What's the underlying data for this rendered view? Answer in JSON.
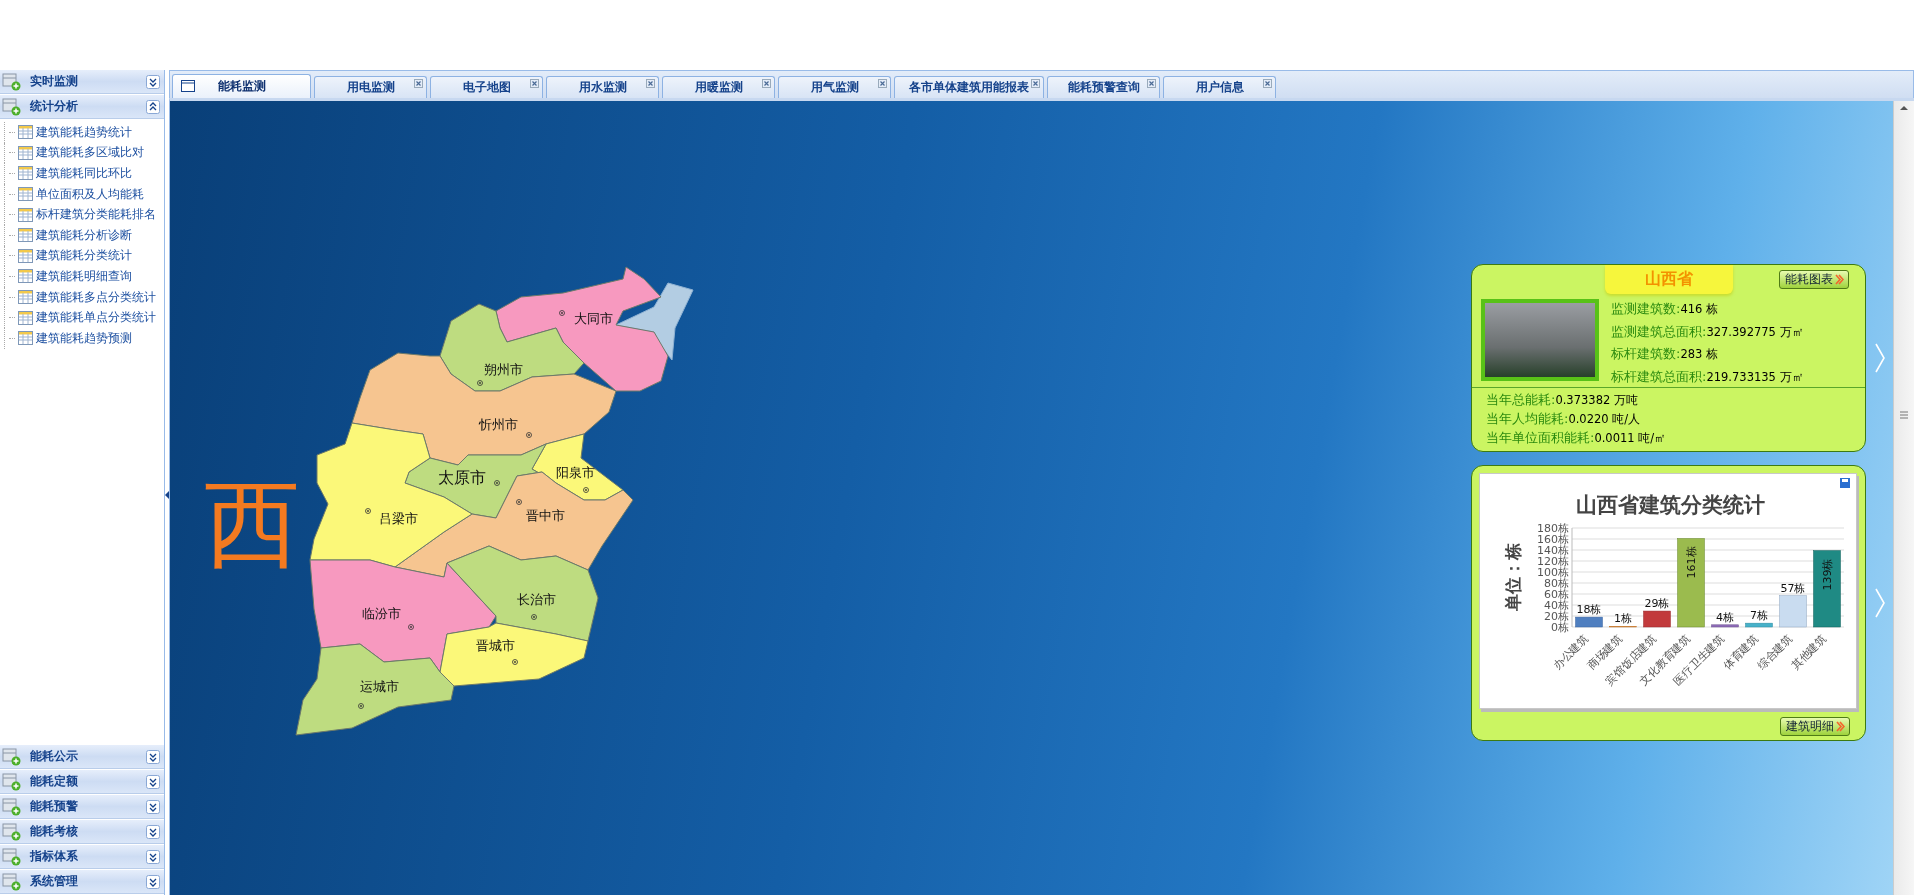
{
  "sidebar": {
    "sections": [
      {
        "label": "实时监测",
        "expanded": false
      },
      {
        "label": "统计分析",
        "expanded": true,
        "items": [
          "建筑能耗趋势统计",
          "建筑能耗多区域比对",
          "建筑能耗同比环比",
          "单位面积及人均能耗",
          "标杆建筑分类能耗排名",
          "建筑能耗分析诊断",
          "建筑能耗分类统计",
          "建筑能耗明细查询",
          "建筑能耗多点分类统计",
          "建筑能耗单点分类统计",
          "建筑能耗趋势预测"
        ]
      },
      {
        "label": "能耗公示",
        "expanded": false
      },
      {
        "label": "能耗定额",
        "expanded": false
      },
      {
        "label": "能耗预警",
        "expanded": false
      },
      {
        "label": "能耗考核",
        "expanded": false
      },
      {
        "label": "指标体系",
        "expanded": false
      },
      {
        "label": "系统管理",
        "expanded": false
      }
    ]
  },
  "tabs": [
    {
      "label": "能耗监测",
      "selected": true,
      "closable": false
    },
    {
      "label": "用电监测",
      "selected": false,
      "closable": true
    },
    {
      "label": "电子地图",
      "selected": false,
      "closable": true
    },
    {
      "label": "用水监测",
      "selected": false,
      "closable": true
    },
    {
      "label": "用暖监测",
      "selected": false,
      "closable": true
    },
    {
      "label": "用气监测",
      "selected": false,
      "closable": true
    },
    {
      "label": "各市单体建筑用能报表",
      "selected": false,
      "closable": true
    },
    {
      "label": "能耗预警查询",
      "selected": false,
      "closable": true
    },
    {
      "label": "用户信息",
      "selected": false,
      "closable": true
    }
  ],
  "map": {
    "title_fragment": "西",
    "regions": [
      {
        "name": "大同市",
        "color": "#f799bf"
      },
      {
        "name": "朔州市",
        "color": "#bedc80"
      },
      {
        "name": "忻州市",
        "color": "#f6c590"
      },
      {
        "name": "阳泉市",
        "color": "#fbf879"
      },
      {
        "name": "太原市",
        "color": "#bedc80"
      },
      {
        "name": "晋中市",
        "color": "#f6c590"
      },
      {
        "name": "吕梁市",
        "color": "#fbf879"
      },
      {
        "name": "临汾市",
        "color": "#f799bf"
      },
      {
        "name": "长治市",
        "color": "#bedc80"
      },
      {
        "name": "晋城市",
        "color": "#fbf879"
      },
      {
        "name": "运城市",
        "color": "#bedc80"
      }
    ]
  },
  "province_panel": {
    "title": "山西省",
    "chart_button": "能耗图表",
    "stats": [
      {
        "label": "监测建筑数:",
        "value": "416 栋"
      },
      {
        "label": "监测建筑总面积:",
        "value": "327.392775 万㎡"
      },
      {
        "label": "标杆建筑数:",
        "value": "283 栋"
      },
      {
        "label": "标杆建筑总面积:",
        "value": "219.733135 万㎡"
      }
    ],
    "totals": [
      {
        "label": "当年总能耗:",
        "value": "0.373382 万吨"
      },
      {
        "label": "当年人均能耗:",
        "value": "0.0220 吨/人"
      },
      {
        "label": "当年单位面积能耗:",
        "value": "0.0011 吨/㎡"
      }
    ]
  },
  "chart_panel": {
    "detail_button": "建筑明细",
    "chart_data": {
      "type": "bar",
      "title": "山西省建筑分类统计",
      "ylabel": "单位：栋",
      "categories": [
        "办公建筑",
        "商场建筑",
        "宾馆饭店建筑",
        "文化教育建筑",
        "医疗卫生建筑",
        "体育建筑",
        "综合建筑",
        "其他建筑"
      ],
      "values": [
        18,
        1,
        29,
        161,
        4,
        7,
        57,
        139
      ],
      "value_labels": [
        "18栋",
        "1栋",
        "29栋",
        "161栋",
        "4栋",
        "7栋",
        "57栋",
        "139栋"
      ],
      "ylim": [
        0,
        180
      ],
      "grid": true,
      "yticks": [
        {
          "value": 0,
          "label": "0栋"
        },
        {
          "value": 20,
          "label": "20栋"
        },
        {
          "value": 40,
          "label": "40栋"
        },
        {
          "value": 60,
          "label": "60栋"
        },
        {
          "value": 80,
          "label": "80栋"
        },
        {
          "value": 100,
          "label": "100栋"
        },
        {
          "value": 120,
          "label": "120栋"
        },
        {
          "value": 140,
          "label": "140栋"
        },
        {
          "value": 160,
          "label": "160栋"
        },
        {
          "value": 180,
          "label": "180栋"
        }
      ]
    }
  }
}
